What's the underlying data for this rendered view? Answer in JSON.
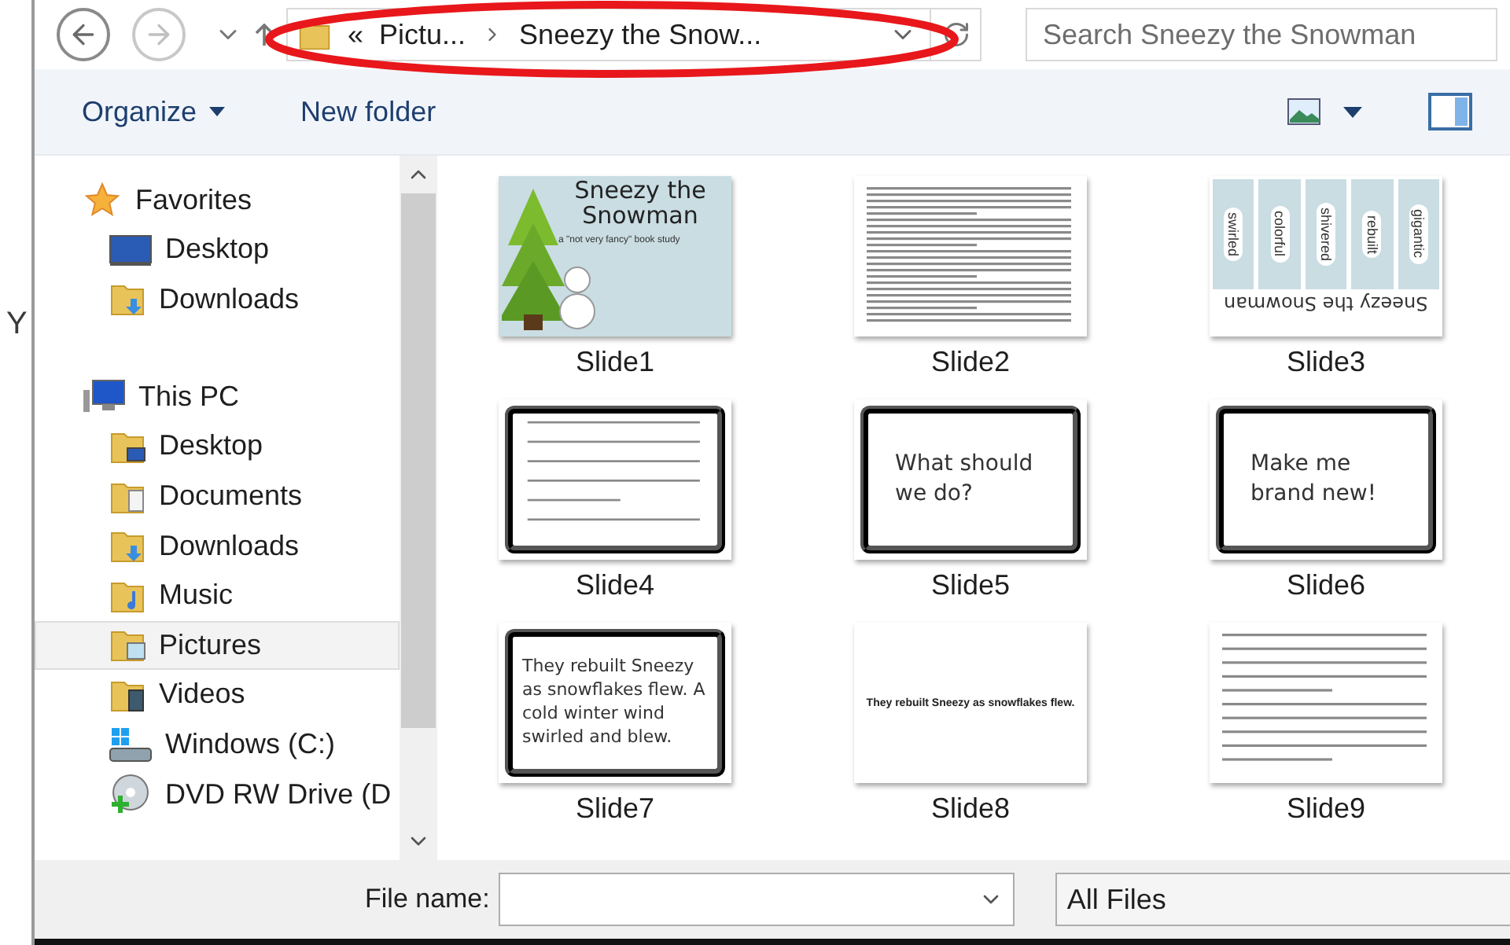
{
  "back_window": {
    "text": "Y"
  },
  "address_bar": {
    "overflow": "«",
    "segments": [
      "Pictu...",
      "Sneezy the Snow..."
    ]
  },
  "search": {
    "placeholder": "Search Sneezy the Snowman"
  },
  "toolbar": {
    "buttons": [
      {
        "label": "Organize",
        "dropdown": true
      },
      {
        "label": "New folder",
        "dropdown": false
      }
    ]
  },
  "nav_pane": {
    "groups": [
      {
        "label": "Favorites",
        "children": [
          {
            "label": "Desktop",
            "selected": false
          },
          {
            "label": "Downloads",
            "selected": false
          }
        ]
      },
      {
        "label": "This PC",
        "children": [
          {
            "label": "Desktop",
            "selected": false
          },
          {
            "label": "Documents",
            "selected": false
          },
          {
            "label": "Downloads",
            "selected": false
          },
          {
            "label": "Music",
            "selected": false
          },
          {
            "label": "Pictures",
            "selected": true
          },
          {
            "label": "Videos",
            "selected": false
          },
          {
            "label": "Windows (C:)",
            "selected": false
          },
          {
            "label": "DVD RW Drive (D",
            "selected": false
          }
        ]
      }
    ]
  },
  "slides": [
    {
      "label": "Slide1",
      "kind": "title",
      "title": "Sneezy the Snowman",
      "subtitle": "a \"not very fancy\" book study"
    },
    {
      "label": "Slide2",
      "kind": "document"
    },
    {
      "label": "Slide3",
      "kind": "word_cards",
      "words": [
        "swirled",
        "colorful",
        "shivered",
        "rebuilt",
        "gigantic"
      ],
      "caption": "Sneezy the Snowman"
    },
    {
      "label": "Slide4",
      "kind": "worksheet"
    },
    {
      "label": "Slide5",
      "kind": "card",
      "text": "What should we do?"
    },
    {
      "label": "Slide6",
      "kind": "card",
      "text": "Make me brand new!"
    },
    {
      "label": "Slide7",
      "kind": "card_left",
      "text": "They rebuilt Sneezy as snowflakes flew. A cold winter wind swirled and blew."
    },
    {
      "label": "Slide8",
      "kind": "plain",
      "text": "They rebuilt Sneezy as snowflakes flew."
    },
    {
      "label": "Slide9",
      "kind": "strips"
    }
  ],
  "footer": {
    "file_name_label": "File name:",
    "filter": "All Files"
  }
}
